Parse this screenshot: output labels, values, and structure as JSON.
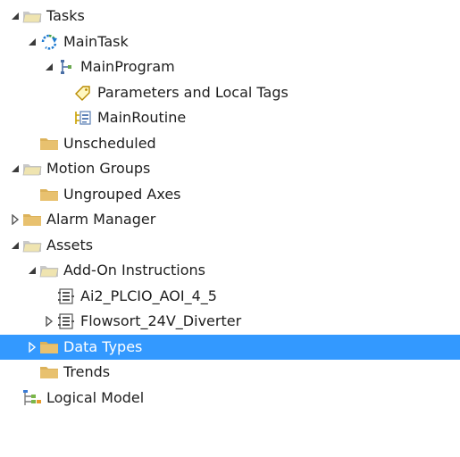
{
  "tree": {
    "items": [
      {
        "label": "Tasks",
        "level": 0,
        "toggle": "expanded",
        "icon": "folder-open-icon"
      },
      {
        "label": "MainTask",
        "level": 1,
        "toggle": "expanded",
        "icon": "continuous-task-icon"
      },
      {
        "label": "MainProgram",
        "level": 2,
        "toggle": "expanded",
        "icon": "program-icon"
      },
      {
        "label": "Parameters and Local Tags",
        "level": 3,
        "toggle": "none",
        "icon": "tag-icon"
      },
      {
        "label": "MainRoutine",
        "level": 3,
        "toggle": "none",
        "icon": "routine-icon"
      },
      {
        "label": "Unscheduled",
        "level": 1,
        "toggle": "none",
        "icon": "folder-closed-icon"
      },
      {
        "label": "Motion Groups",
        "level": 0,
        "toggle": "expanded",
        "icon": "folder-open-icon"
      },
      {
        "label": "Ungrouped Axes",
        "level": 1,
        "toggle": "none",
        "icon": "folder-closed-icon"
      },
      {
        "label": "Alarm Manager",
        "level": 0,
        "toggle": "collapsed",
        "icon": "folder-closed-icon"
      },
      {
        "label": "Assets",
        "level": 0,
        "toggle": "expanded",
        "icon": "folder-open-icon"
      },
      {
        "label": "Add-On Instructions",
        "level": 1,
        "toggle": "expanded",
        "icon": "folder-open-icon"
      },
      {
        "label": "Ai2_PLCIO_AOI_4_5",
        "level": 2,
        "toggle": "none",
        "icon": "aoi-icon"
      },
      {
        "label": "Flowsort_24V_Diverter",
        "level": 2,
        "toggle": "collapsed",
        "icon": "aoi-icon"
      },
      {
        "label": "Data Types",
        "level": 1,
        "toggle": "collapsed",
        "icon": "folder-closed-icon",
        "selected": true
      },
      {
        "label": "Trends",
        "level": 1,
        "toggle": "none",
        "icon": "folder-closed-icon"
      },
      {
        "label": "Logical Model",
        "level": 0,
        "toggle": "none",
        "icon": "logical-model-icon"
      }
    ]
  },
  "colors": {
    "selection": "#3399ff",
    "folder": "#dcb25a",
    "folder_open": "#efe4b0",
    "task_blue": "#1e7ad0",
    "task_green": "#47a347"
  }
}
